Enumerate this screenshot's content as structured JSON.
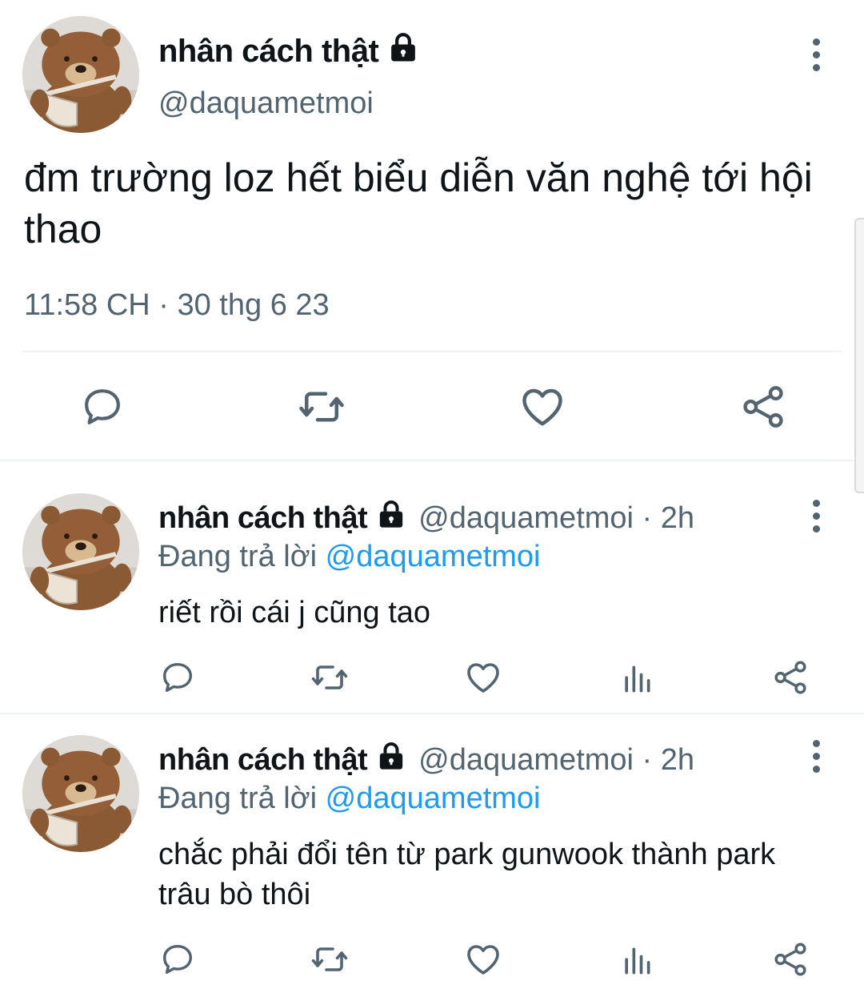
{
  "main_tweet": {
    "display_name": "nhân cách thật",
    "handle": "@daquametmoi",
    "text": "đm trường loz hết biểu diễn văn nghệ tới hội thao",
    "timestamp": "11:58 CH · 30 thg 6 23"
  },
  "replies": [
    {
      "display_name": "nhân cách thật",
      "handle_time": "@daquametmoi · 2h",
      "replying_label": "Đang trả lời",
      "replying_to": "@daquametmoi",
      "text": "riết rồi cái j cũng tao"
    },
    {
      "display_name": "nhân cách thật",
      "handle_time": "@daquametmoi · 2h",
      "replying_label": "Đang trả lời",
      "replying_to": "@daquametmoi",
      "text": "chắc phải đổi tên từ park gunwook thành park trâu bò thôi"
    }
  ],
  "icons": {
    "reply": "reply-icon",
    "retweet": "retweet-icon",
    "like": "like-icon",
    "views": "views-icon",
    "share": "share-icon",
    "lock": "lock-icon",
    "more": "more-icon"
  },
  "colors": {
    "text": "#0f1419",
    "secondary": "#536471",
    "accent": "#1d9bf0",
    "divider": "#eff3f4"
  }
}
